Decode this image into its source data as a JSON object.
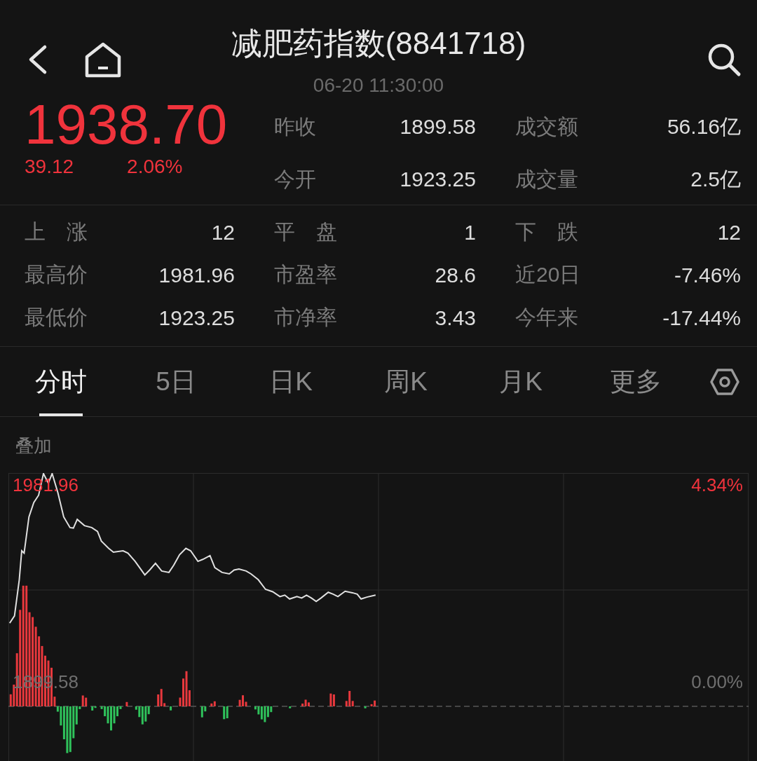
{
  "header": {
    "title": "减肥药指数(8841718)",
    "time": "06-20 11:30:00"
  },
  "quote": {
    "price": "1938.70",
    "change": "39.12",
    "change_pct": "2.06%"
  },
  "stats_top": [
    [
      {
        "label": "昨收",
        "value": "1899.58"
      },
      {
        "label": "成交额",
        "value": "56.16亿"
      }
    ],
    [
      {
        "label": "今开",
        "value": "1923.25"
      },
      {
        "label": "成交量",
        "value": "2.5亿"
      }
    ]
  ],
  "stats_bottom": [
    [
      {
        "label": "上　涨",
        "value": "12"
      },
      {
        "label": "平　盘",
        "value": "1"
      },
      {
        "label": "下　跌",
        "value": "12"
      }
    ],
    [
      {
        "label": "最高价",
        "value": "1981.96"
      },
      {
        "label": "市盈率",
        "value": "28.6"
      },
      {
        "label": "近20日",
        "value": "-7.46%"
      }
    ],
    [
      {
        "label": "最低价",
        "value": "1923.25"
      },
      {
        "label": "市净率",
        "value": "3.43"
      },
      {
        "label": "今年来",
        "value": "-17.44%"
      }
    ]
  ],
  "tabs": [
    {
      "label": "分时",
      "selected": true
    },
    {
      "label": "5日",
      "selected": false
    },
    {
      "label": "日K",
      "selected": false
    },
    {
      "label": "周K",
      "selected": false
    },
    {
      "label": "月K",
      "selected": false
    },
    {
      "label": "更多",
      "selected": false
    }
  ],
  "chart": {
    "overlay_label": "叠加",
    "high": "1981.96",
    "high_pct": "4.34%",
    "base": "1899.58",
    "base_pct": "0.00%"
  }
}
